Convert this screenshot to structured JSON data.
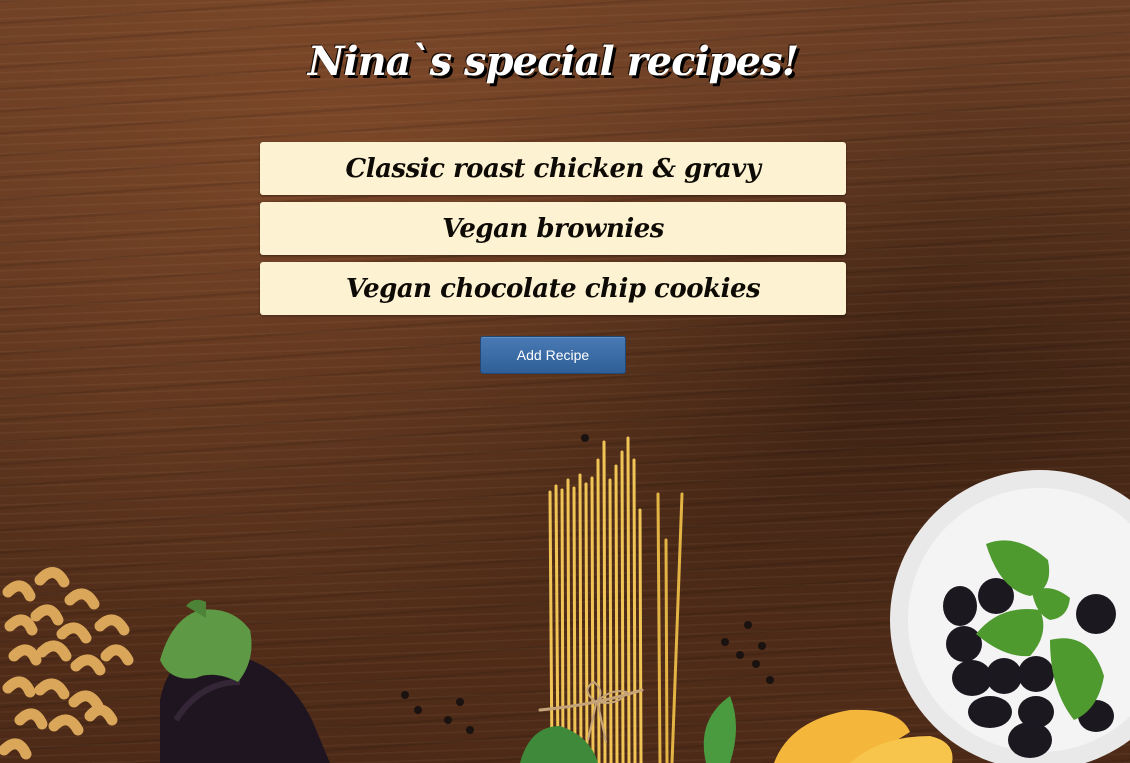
{
  "header": {
    "title": "Nina`s special recipes!"
  },
  "recipes": [
    {
      "label": "Classic roast chicken & gravy"
    },
    {
      "label": "Vegan brownies"
    },
    {
      "label": "Vegan chocolate chip cookies"
    }
  ],
  "actions": {
    "add_recipe_label": "Add Recipe"
  },
  "colors": {
    "recipe_card": "#fdf3d2",
    "button": "#3a6aa6",
    "title": "#ffffff"
  }
}
